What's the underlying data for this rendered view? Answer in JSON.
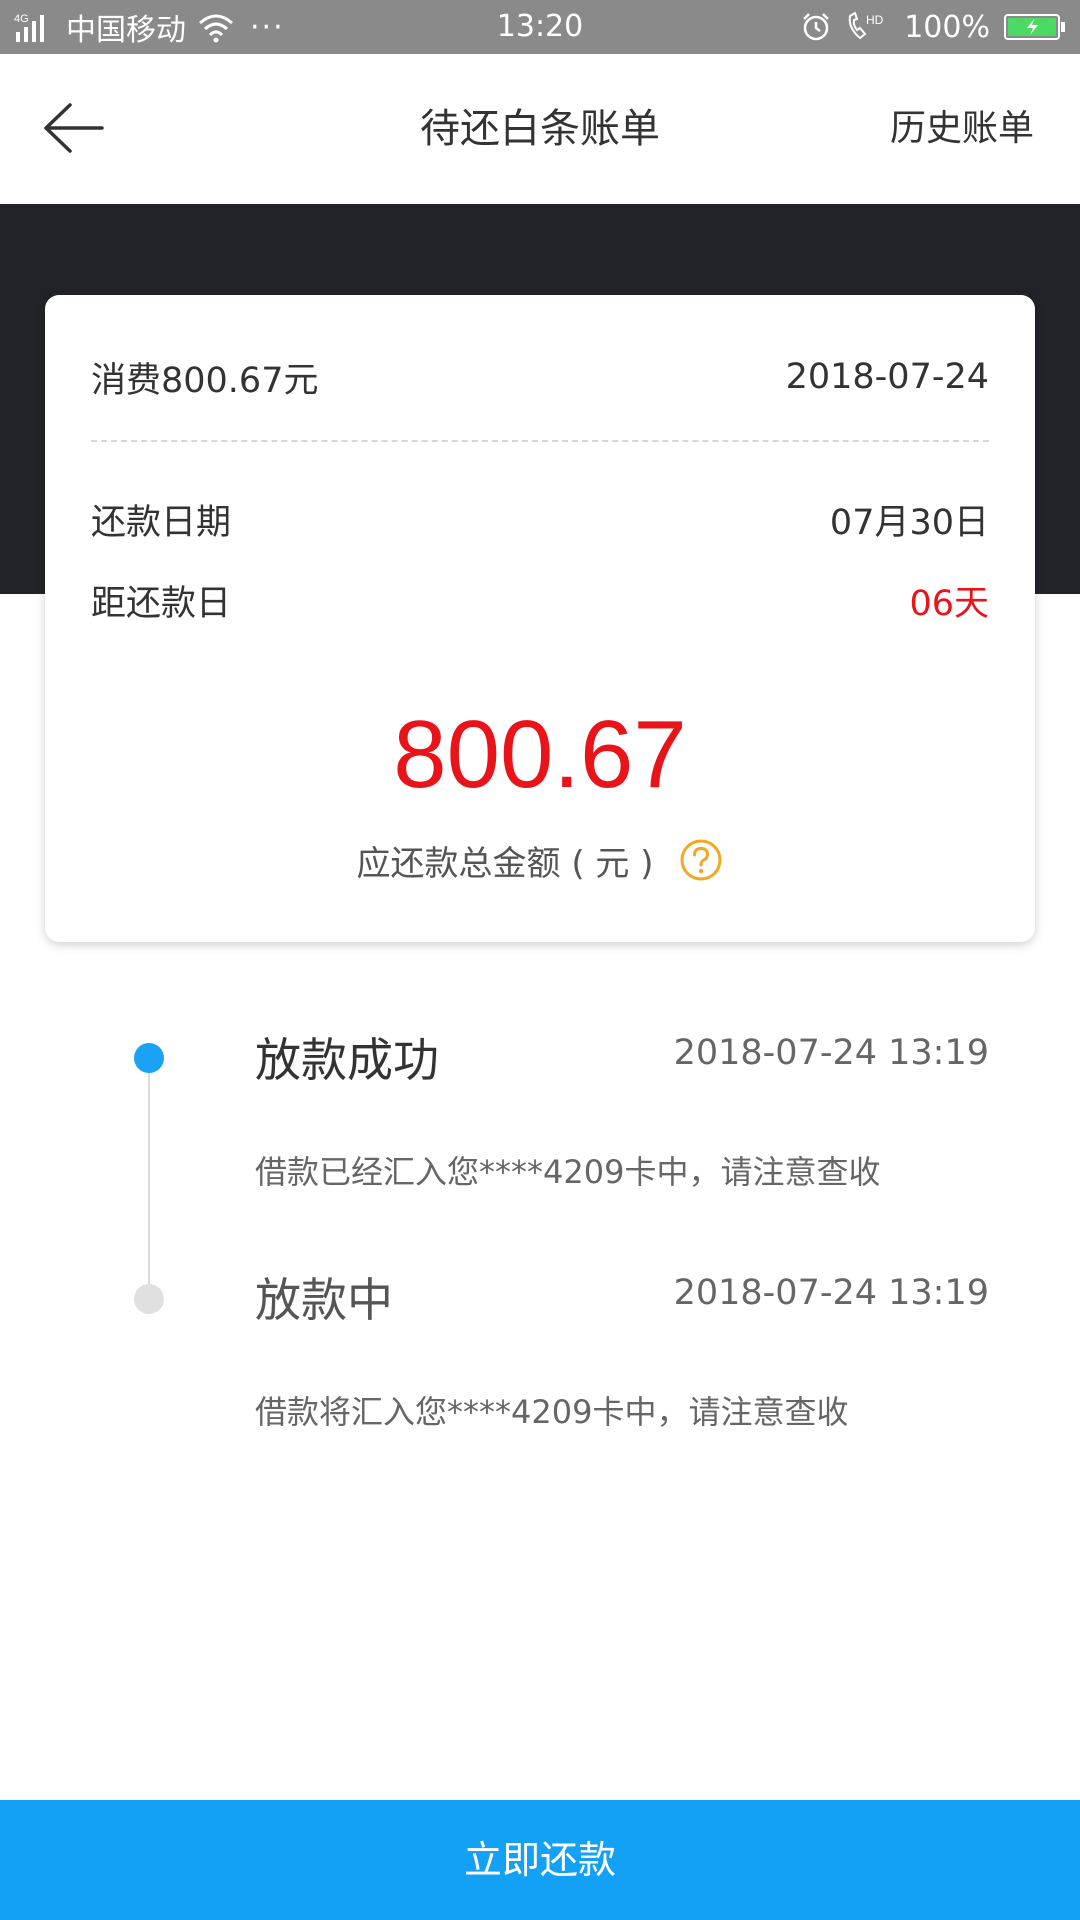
{
  "status_bar": {
    "network": "4G",
    "carrier": "中国移动",
    "more": "···",
    "time": "13:20",
    "battery": "100%"
  },
  "nav": {
    "title": "待还白条账单",
    "history": "历史账单"
  },
  "bill": {
    "consume_label": "消费800.67元",
    "consume_date": "2018-07-24",
    "due_date_label": "还款日期",
    "due_date_value": "07月30日",
    "days_left_label": "距还款日",
    "days_left_value": "06天",
    "total_amount": "800.67",
    "total_label": "应还款总金额 ( 元 )"
  },
  "timeline": [
    {
      "title": "放款成功",
      "time": "2018-07-24 13:19",
      "desc": "借款已经汇入您****4209卡中，请注意查收",
      "active": true
    },
    {
      "title": "放款中",
      "time": "2018-07-24 13:19",
      "desc": "借款将汇入您****4209卡中，请注意查收",
      "active": false
    }
  ],
  "actions": {
    "repay": "立即还款"
  },
  "colors": {
    "accent": "#13a1f5",
    "highlight_red": "#e8141a",
    "help_orange": "#f5a623",
    "dark_header": "#222328"
  }
}
